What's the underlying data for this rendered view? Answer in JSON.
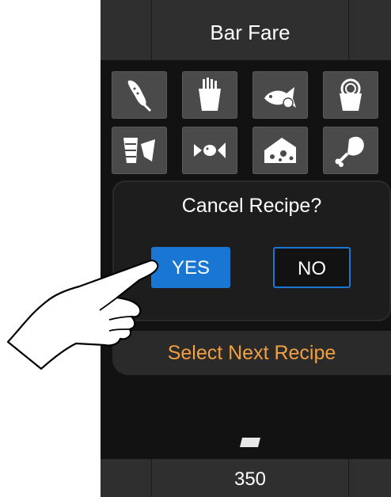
{
  "header": {
    "title": "Bar Fare"
  },
  "categories": [
    {
      "icon": "corn-dog-icon"
    },
    {
      "icon": "fries-icon"
    },
    {
      "icon": "fish-icon"
    },
    {
      "icon": "snack-bowl-icon"
    },
    {
      "icon": "cups-icon"
    },
    {
      "icon": "shrimp-icon"
    },
    {
      "icon": "cheese-icon"
    },
    {
      "icon": "drumstick-icon"
    }
  ],
  "dialog": {
    "question": "Cancel Recipe?",
    "yes_label": "YES",
    "no_label": "NO"
  },
  "next_recipe_label": "Select Next Recipe",
  "footer": {
    "value": "350"
  },
  "colors": {
    "accent": "#1976d2",
    "next_text": "#f0a040"
  }
}
